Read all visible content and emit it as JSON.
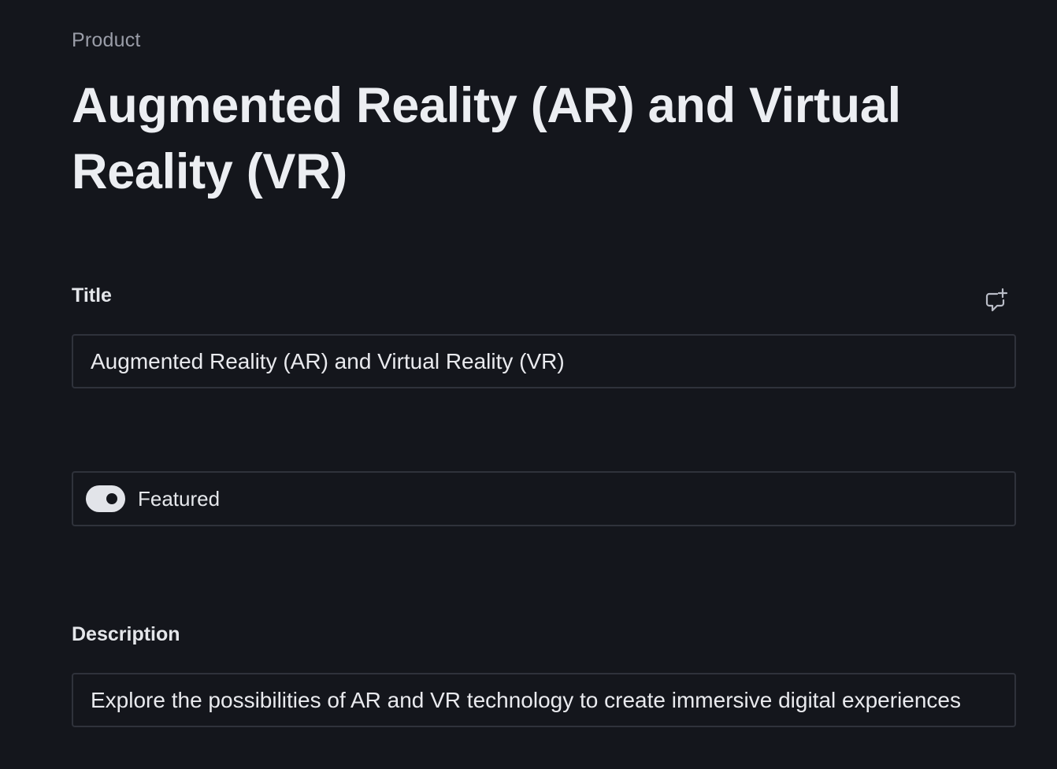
{
  "header": {
    "eyebrow": "Product",
    "title": "Augmented Reality (AR) and Virtual Reality (VR)"
  },
  "fields": {
    "title": {
      "label": "Title",
      "value": "Augmented Reality (AR) and Virtual Reality (VR)",
      "comment_icon": "add-comment-icon"
    },
    "featured": {
      "label": "Featured",
      "checked": true
    },
    "description": {
      "label": "Description",
      "value": "Explore the possibilities of AR and VR technology to create immersive digital experiences"
    }
  },
  "colors": {
    "background": "#14161c",
    "border": "#2f323b",
    "text": "#e9eaee",
    "muted": "#9a9da8",
    "switch_on": "#e2e4e9"
  }
}
